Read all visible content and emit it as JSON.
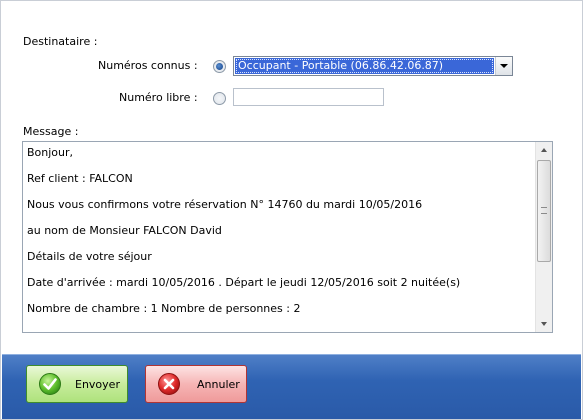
{
  "destinataire": {
    "section_label": "Destinataire :",
    "known_numbers_label": "Numéros connus :",
    "known_numbers_selected": "Occupant - Portable (06.86.42.06.87)",
    "free_number_label": "Numéro libre :",
    "free_number_value": ""
  },
  "message": {
    "label": "Message :",
    "lines": [
      "Bonjour,",
      "Ref client :  FALCON",
      "Nous vous confirmons votre réservation N° 14760 du mardi 10/05/2016",
      "au nom de Monsieur FALCON David",
      "Détails de votre séjour",
      "Date d'arrivée :  mardi 10/05/2016 . Départ le  jeudi 12/05/2016 soit  2 nuitée(s)",
      "Nombre de chambre :  1    Nombre de personnes : 2"
    ]
  },
  "buttons": {
    "send_label": "Envoyer",
    "cancel_label": "Annuler"
  },
  "colors": {
    "selection": "#3a67d8",
    "footer": "#2f63b3",
    "ok_green": "#aee27c",
    "cancel_red": "#ef9a9a"
  }
}
